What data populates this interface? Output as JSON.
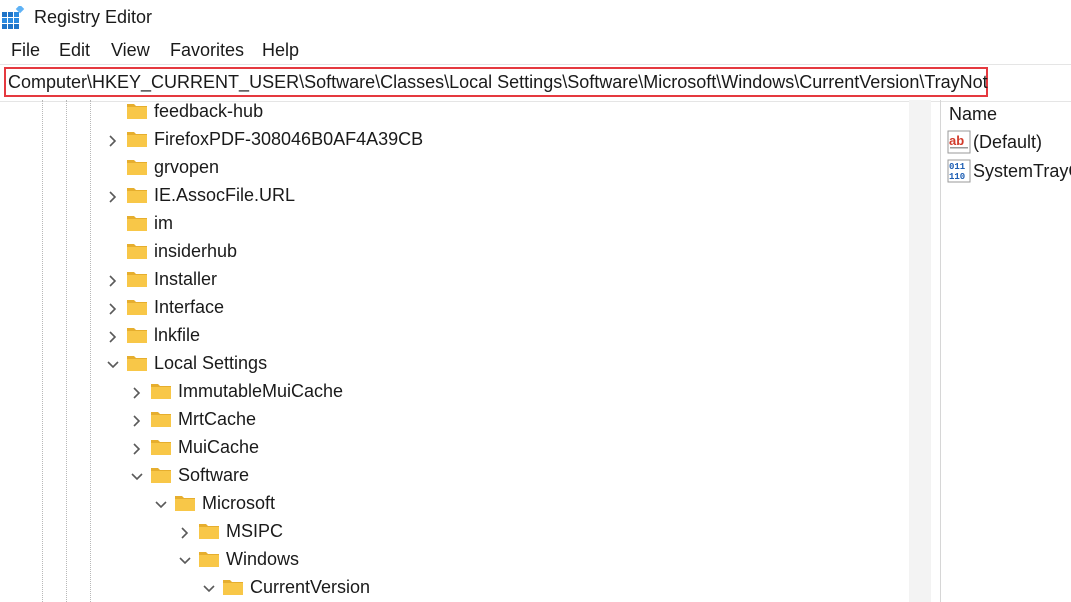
{
  "window": {
    "title": "Registry Editor",
    "app_icon": "registry-editor-icon"
  },
  "menu": [
    "File",
    "Edit",
    "View",
    "Favorites",
    "Help"
  ],
  "address": {
    "value": "Computer\\HKEY_CURRENT_USER\\Software\\Classes\\Local Settings\\Software\\Microsoft\\Windows\\CurrentVersion\\TrayNotify",
    "highlight_color": "#e5393f"
  },
  "tree": {
    "folder_color": "#f8c748",
    "nodes": [
      {
        "label": "feedback-hub",
        "depth": 0,
        "state": "none"
      },
      {
        "label": "FirefoxPDF-308046B0AF4A39CB",
        "depth": 0,
        "state": "collapsed"
      },
      {
        "label": "grvopen",
        "depth": 0,
        "state": "none"
      },
      {
        "label": "IE.AssocFile.URL",
        "depth": 0,
        "state": "collapsed"
      },
      {
        "label": "im",
        "depth": 0,
        "state": "none"
      },
      {
        "label": "insiderhub",
        "depth": 0,
        "state": "none"
      },
      {
        "label": "Installer",
        "depth": 0,
        "state": "collapsed"
      },
      {
        "label": "Interface",
        "depth": 0,
        "state": "collapsed"
      },
      {
        "label": "lnkfile",
        "depth": 0,
        "state": "collapsed"
      },
      {
        "label": "Local Settings",
        "depth": 0,
        "state": "expanded"
      },
      {
        "label": "ImmutableMuiCache",
        "depth": 1,
        "state": "collapsed"
      },
      {
        "label": "MrtCache",
        "depth": 1,
        "state": "collapsed"
      },
      {
        "label": "MuiCache",
        "depth": 1,
        "state": "collapsed"
      },
      {
        "label": "Software",
        "depth": 1,
        "state": "expanded"
      },
      {
        "label": "Microsoft",
        "depth": 2,
        "state": "expanded"
      },
      {
        "label": "MSIPC",
        "depth": 3,
        "state": "collapsed"
      },
      {
        "label": "Windows",
        "depth": 3,
        "state": "expanded"
      },
      {
        "label": "CurrentVersion",
        "depth": 4,
        "state": "expanded"
      }
    ]
  },
  "values": {
    "column_header": "Name",
    "items": [
      {
        "name": "(Default)",
        "icon": "string-value-icon"
      },
      {
        "name": "SystemTrayC",
        "icon": "binary-value-icon"
      }
    ]
  }
}
